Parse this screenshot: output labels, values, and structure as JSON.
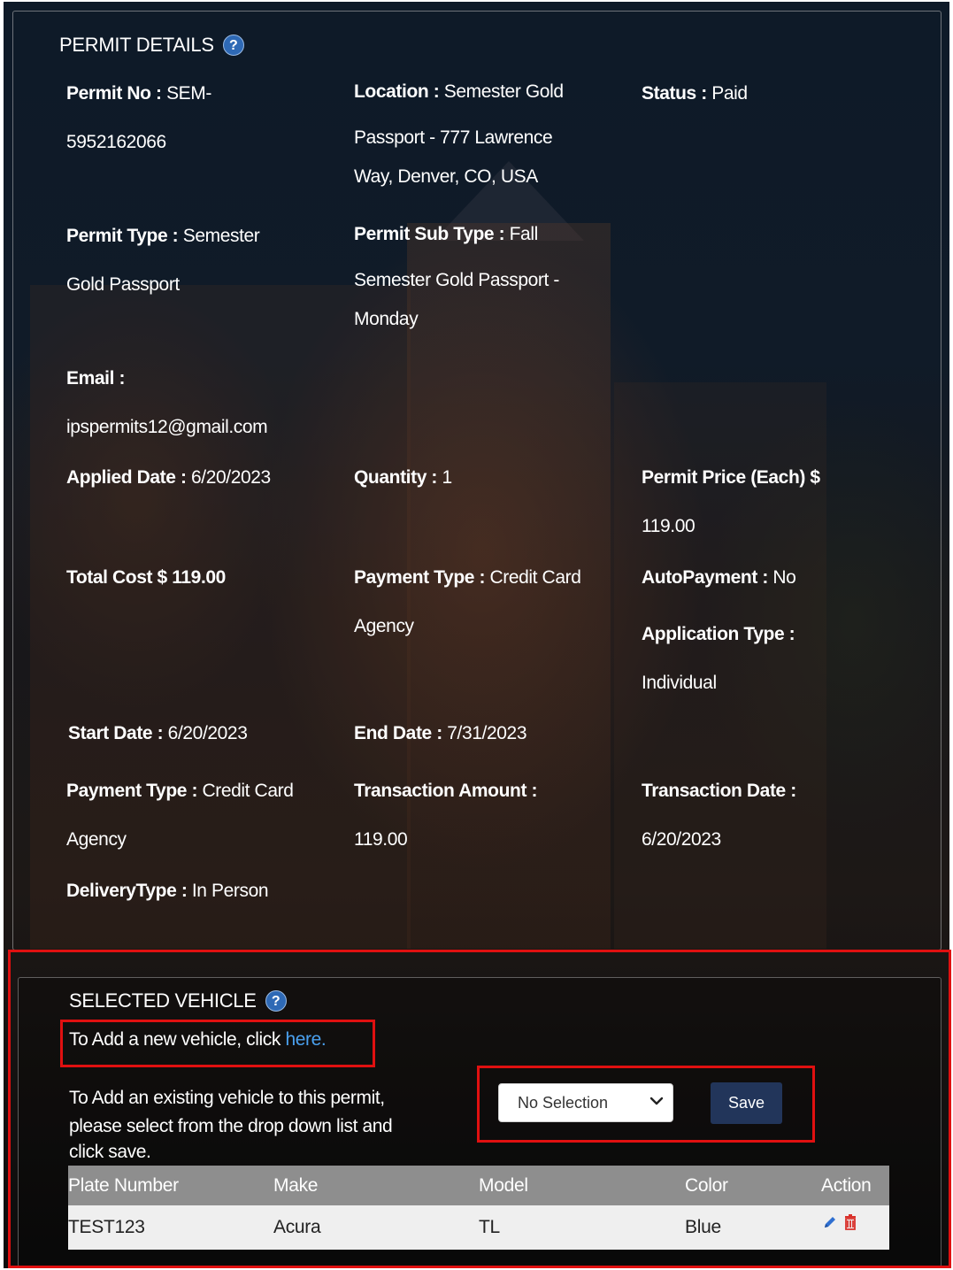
{
  "permit_details": {
    "title": "PERMIT DETAILS",
    "help_icon": "?",
    "fields": {
      "permit_no": {
        "label": "Permit No :",
        "line1": "SEM-",
        "line2": "5952162066"
      },
      "location": {
        "label": "Location :",
        "line1": "Semester Gold",
        "line2": "Passport - 777 Lawrence",
        "line3": "Way, Denver, CO, USA"
      },
      "status": {
        "label": "Status :",
        "value": "Paid"
      },
      "permit_type": {
        "label": "Permit Type :",
        "line1": "Semester",
        "line2": "Gold Passport"
      },
      "permit_sub_type": {
        "label": "Permit Sub Type :",
        "line1": "Fall",
        "line2": "Semester Gold Passport -",
        "line3": "Monday"
      },
      "email": {
        "label": "Email :",
        "value": "ipspermits12@gmail.com"
      },
      "applied_date": {
        "label": "Applied Date :",
        "value": "6/20/2023"
      },
      "quantity": {
        "label": "Quantity :",
        "value": "1"
      },
      "permit_price": {
        "label": "Permit Price (Each) $",
        "value": "119.00"
      },
      "total_cost": {
        "label": "Total Cost $",
        "value": "119.00"
      },
      "payment_type": {
        "label": "Payment Type :",
        "line1": "Credit Card",
        "line2": "Agency"
      },
      "autopayment": {
        "label": "AutoPayment :",
        "value": "No"
      },
      "application_type": {
        "label": "Application Type :",
        "value": "Individual"
      },
      "start_date": {
        "label": "Start Date :",
        "value": "6/20/2023"
      },
      "end_date": {
        "label": "End Date :",
        "value": "7/31/2023"
      },
      "payment_type_2": {
        "label": "Payment Type :",
        "line1": "Credit Card",
        "line2": "Agency"
      },
      "transaction_amount": {
        "label": "Transaction Amount :",
        "value": "119.00"
      },
      "transaction_date": {
        "label": "Transaction Date :",
        "value": "6/20/2023"
      },
      "delivery_type": {
        "label": "DeliveryType :",
        "value": "In Person"
      }
    }
  },
  "selected_vehicle": {
    "title": "SELECTED VEHICLE",
    "help_icon": "?",
    "add_new_prefix": "To Add a new vehicle, click ",
    "add_new_link": "here.",
    "existing_line1": "To Add an existing vehicle to this permit,",
    "existing_line2": "please select from the drop down list and",
    "existing_line3": "click save.",
    "dropdown_value": "No Selection",
    "save_label": "Save",
    "table": {
      "headers": [
        "Plate Number",
        "Make",
        "Model",
        "Color",
        "Action"
      ],
      "rows": [
        {
          "plate": "TEST123",
          "make": "Acura",
          "model": "TL",
          "color": "Blue"
        }
      ]
    }
  },
  "colors": {
    "highlight_border": "#e01010",
    "link": "#4aa0ee",
    "save_button": "#22355a",
    "help_badge": "#2e69b5",
    "edit_icon": "#2f6fd0",
    "delete_icon": "#d9302a"
  },
  "icons": [
    "help-icon",
    "chevron-down-icon",
    "edit-pencil-icon",
    "delete-trash-icon"
  ]
}
